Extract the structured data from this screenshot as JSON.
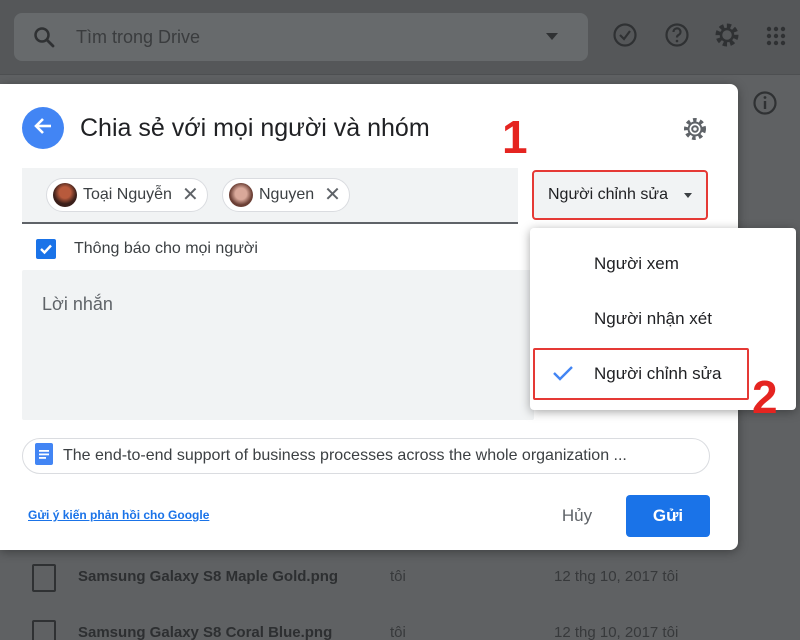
{
  "drive": {
    "search_placeholder": "Tìm trong Drive",
    "files": [
      {
        "name": "Samsung Galaxy S8 Maple Gold.png",
        "owner": "tôi",
        "date": "12 thg 10, 2017 tôi"
      },
      {
        "name": "Samsung Galaxy S8 Coral Blue.png",
        "owner": "tôi",
        "date": "12 thg 10, 2017 tôi"
      }
    ]
  },
  "dialog": {
    "title": "Chia sẻ với mọi người và nhóm",
    "people": [
      {
        "name": "Toại Nguyễn"
      },
      {
        "name": "Nguyen"
      }
    ],
    "role_selected": "Người chỉnh sửa",
    "notify_label": "Thông báo cho mọi người",
    "notify_checked": true,
    "message_placeholder": "Lời nhắn",
    "document_name": "The end-to-end support of business processes across the whole organization ...",
    "feedback_link": "Gửi ý kiến phản hồi cho Google",
    "cancel_label": "Hủy",
    "send_label": "Gửi"
  },
  "role_menu": {
    "options": [
      {
        "label": "Người xem",
        "selected": false
      },
      {
        "label": "Người nhận xét",
        "selected": false
      },
      {
        "label": "Người chỉnh sửa",
        "selected": true
      }
    ]
  },
  "annotations": {
    "step1": "1",
    "step2": "2"
  },
  "colors": {
    "accent": "#1a73e8",
    "back_button": "#4285f4",
    "highlight": "#e53935"
  }
}
